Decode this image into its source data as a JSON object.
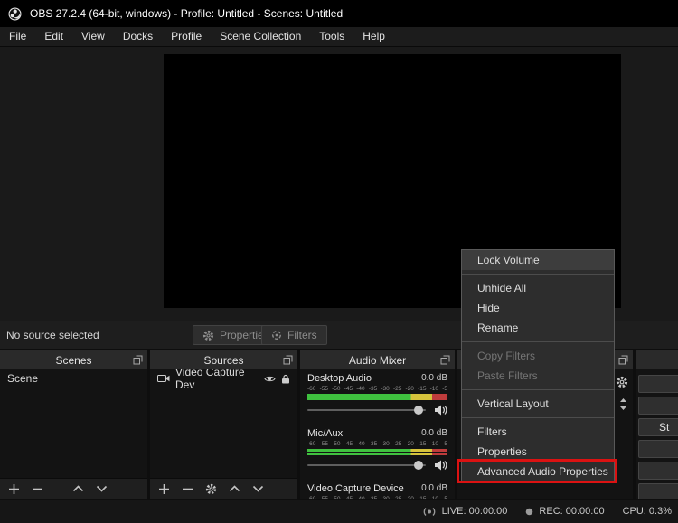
{
  "titlebar": {
    "title": "OBS 27.2.4 (64-bit, windows) - Profile: Untitled - Scenes: Untitled"
  },
  "menubar": {
    "items": [
      "File",
      "Edit",
      "View",
      "Docks",
      "Profile",
      "Scene Collection",
      "Tools",
      "Help"
    ]
  },
  "source_toolbar": {
    "status": "No source selected",
    "properties": "Properties",
    "filters": "Filters"
  },
  "docks": {
    "scenes": {
      "title": "Scenes",
      "items": [
        "Scene"
      ]
    },
    "sources": {
      "title": "Sources",
      "items": [
        "Video Capture Dev"
      ]
    },
    "mixer": {
      "title": "Audio Mixer",
      "scale_ticks": [
        "-60",
        "-55",
        "-50",
        "-45",
        "-40",
        "-35",
        "-30",
        "-25",
        "-20",
        "-15",
        "-10",
        "-5"
      ],
      "channels": [
        {
          "name": "Desktop Audio",
          "value": "0.0 dB"
        },
        {
          "name": "Mic/Aux",
          "value": "0.0 dB"
        },
        {
          "name": "Video Capture Device",
          "value": "0.0 dB"
        }
      ]
    },
    "controls_partial": {
      "visible_text": "St"
    }
  },
  "context_menu": {
    "items": [
      {
        "label": "Lock Volume"
      },
      {
        "label": "Unhide All"
      },
      {
        "label": "Hide"
      },
      {
        "label": "Rename"
      },
      {
        "label": "Copy Filters",
        "disabled": true
      },
      {
        "label": "Paste Filters",
        "disabled": true
      },
      {
        "label": "Vertical Layout"
      },
      {
        "label": "Filters"
      },
      {
        "label": "Properties"
      },
      {
        "label": "Advanced Audio Properties",
        "annotated": true
      }
    ]
  },
  "statusbar": {
    "live": "LIVE: 00:00:00",
    "rec": "REC: 00:00:00",
    "cpu": "CPU: 0.3%"
  },
  "colors": {
    "annotation_red": "#db1212",
    "meter_green": "#3fc13f",
    "meter_yellow": "#d6c33c",
    "meter_red": "#bf3c3c",
    "canvas_black": "#000000"
  }
}
